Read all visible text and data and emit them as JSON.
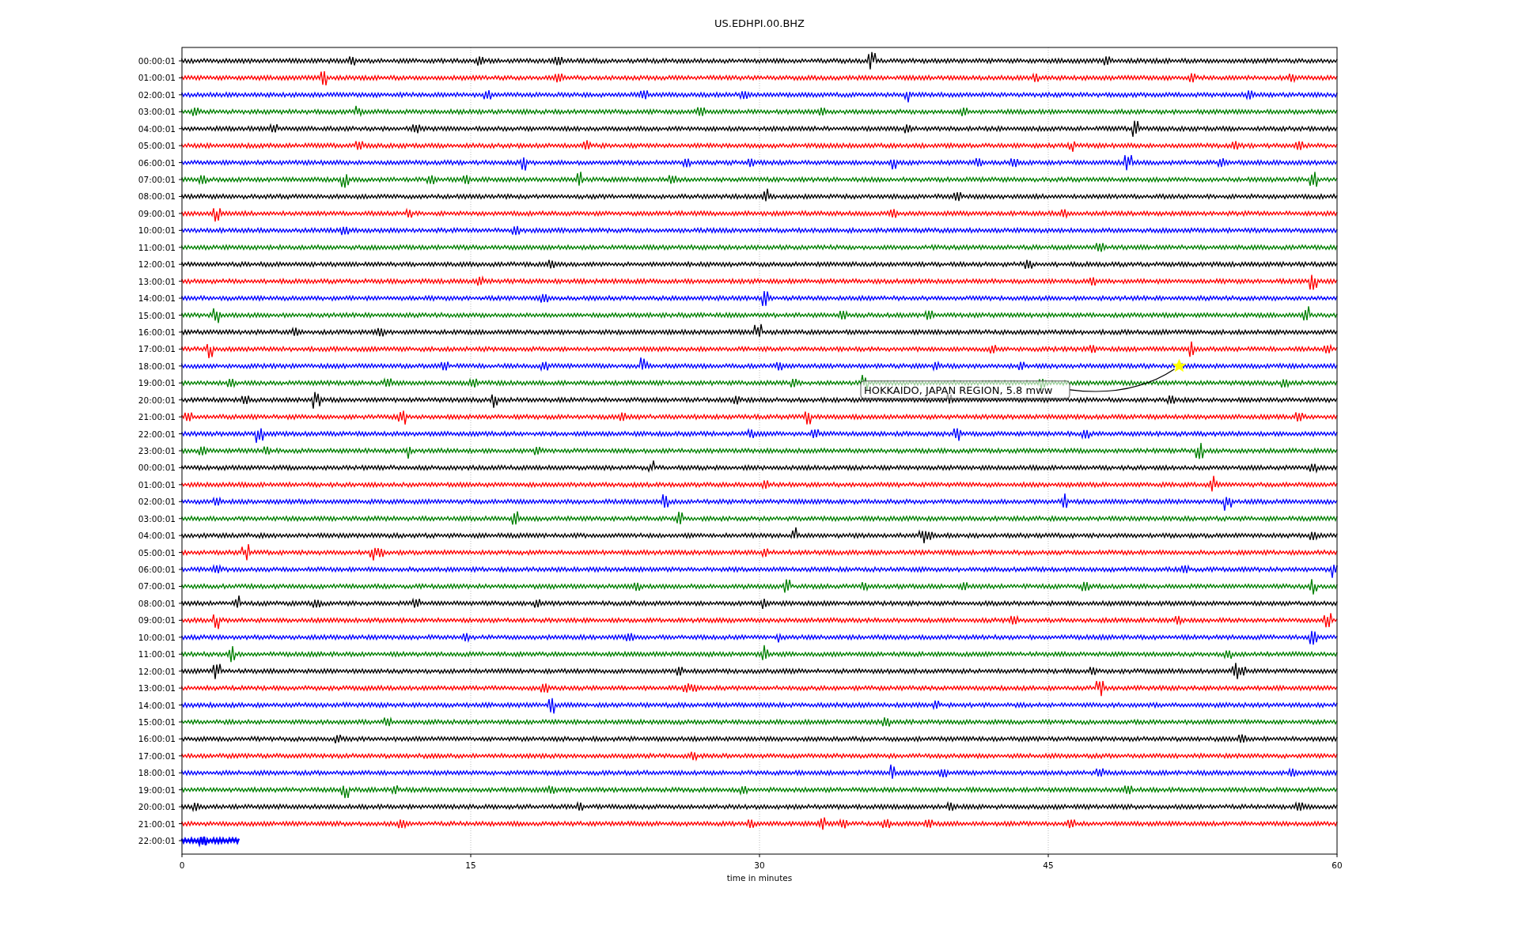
{
  "title": "US.EDHPI.00.BHZ",
  "rows": [
    {
      "label": "00:00:01",
      "color": "#000000",
      "kind": "full"
    },
    {
      "label": "01:00:01",
      "color": "#ff0000",
      "kind": "full"
    },
    {
      "label": "02:00:01",
      "color": "#0000ff",
      "kind": "full"
    },
    {
      "label": "03:00:01",
      "color": "#008000",
      "kind": "full"
    },
    {
      "label": "04:00:01",
      "color": "#000000",
      "kind": "full"
    },
    {
      "label": "05:00:01",
      "color": "#ff0000",
      "kind": "full"
    },
    {
      "label": "06:00:01",
      "color": "#0000ff",
      "kind": "full"
    },
    {
      "label": "07:00:01",
      "color": "#008000",
      "kind": "full"
    },
    {
      "label": "08:00:01",
      "color": "#000000",
      "kind": "full"
    },
    {
      "label": "09:00:01",
      "color": "#ff0000",
      "kind": "full"
    },
    {
      "label": "10:00:01",
      "color": "#0000ff",
      "kind": "full"
    },
    {
      "label": "11:00:01",
      "color": "#008000",
      "kind": "full"
    },
    {
      "label": "12:00:01",
      "color": "#000000",
      "kind": "full"
    },
    {
      "label": "13:00:01",
      "color": "#ff0000",
      "kind": "full"
    },
    {
      "label": "14:00:01",
      "color": "#0000ff",
      "kind": "full"
    },
    {
      "label": "15:00:01",
      "color": "#008000",
      "kind": "full"
    },
    {
      "label": "16:00:01",
      "color": "#000000",
      "kind": "full"
    },
    {
      "label": "17:00:01",
      "color": "#ff0000",
      "kind": "full"
    },
    {
      "label": "18:00:01",
      "color": "#0000ff",
      "kind": "full",
      "event": "HOKKAIDO, JAPAN REGION, 5.8 mww"
    },
    {
      "label": "19:00:01",
      "color": "#008000",
      "kind": "full"
    },
    {
      "label": "20:00:01",
      "color": "#000000",
      "kind": "full"
    },
    {
      "label": "21:00:01",
      "color": "#ff0000",
      "kind": "full"
    },
    {
      "label": "22:00:01",
      "color": "#0000ff",
      "kind": "full"
    },
    {
      "label": "23:00:01",
      "color": "#008000",
      "kind": "full"
    },
    {
      "label": "00:00:01",
      "color": "#000000",
      "kind": "full"
    },
    {
      "label": "01:00:01",
      "color": "#ff0000",
      "kind": "full"
    },
    {
      "label": "02:00:01",
      "color": "#0000ff",
      "kind": "full"
    },
    {
      "label": "03:00:01",
      "color": "#008000",
      "kind": "full"
    },
    {
      "label": "04:00:01",
      "color": "#000000",
      "kind": "full"
    },
    {
      "label": "05:00:01",
      "color": "#ff0000",
      "kind": "full"
    },
    {
      "label": "06:00:01",
      "color": "#0000ff",
      "kind": "full"
    },
    {
      "label": "07:00:01",
      "color": "#008000",
      "kind": "full"
    },
    {
      "label": "08:00:01",
      "color": "#000000",
      "kind": "full"
    },
    {
      "label": "09:00:01",
      "color": "#ff0000",
      "kind": "full"
    },
    {
      "label": "10:00:01",
      "color": "#0000ff",
      "kind": "full"
    },
    {
      "label": "11:00:01",
      "color": "#008000",
      "kind": "full"
    },
    {
      "label": "12:00:01",
      "color": "#000000",
      "kind": "full"
    },
    {
      "label": "13:00:01",
      "color": "#ff0000",
      "kind": "full"
    },
    {
      "label": "14:00:01",
      "color": "#0000ff",
      "kind": "full"
    },
    {
      "label": "15:00:01",
      "color": "#008000",
      "kind": "full"
    },
    {
      "label": "16:00:01",
      "color": "#000000",
      "kind": "full"
    },
    {
      "label": "17:00:01",
      "color": "#ff0000",
      "kind": "full"
    },
    {
      "label": "18:00:01",
      "color": "#0000ff",
      "kind": "full"
    },
    {
      "label": "19:00:01",
      "color": "#008000",
      "kind": "full"
    },
    {
      "label": "20:00:01",
      "color": "#000000",
      "kind": "full"
    },
    {
      "label": "21:00:01",
      "color": "#ff0000",
      "kind": "full"
    },
    {
      "label": "22:00:01",
      "color": "#0000ff",
      "kind": "partial"
    }
  ],
  "x_axis": {
    "ticks": [
      "0",
      "15",
      "30",
      "45",
      "60"
    ],
    "label": "time in minutes"
  }
}
